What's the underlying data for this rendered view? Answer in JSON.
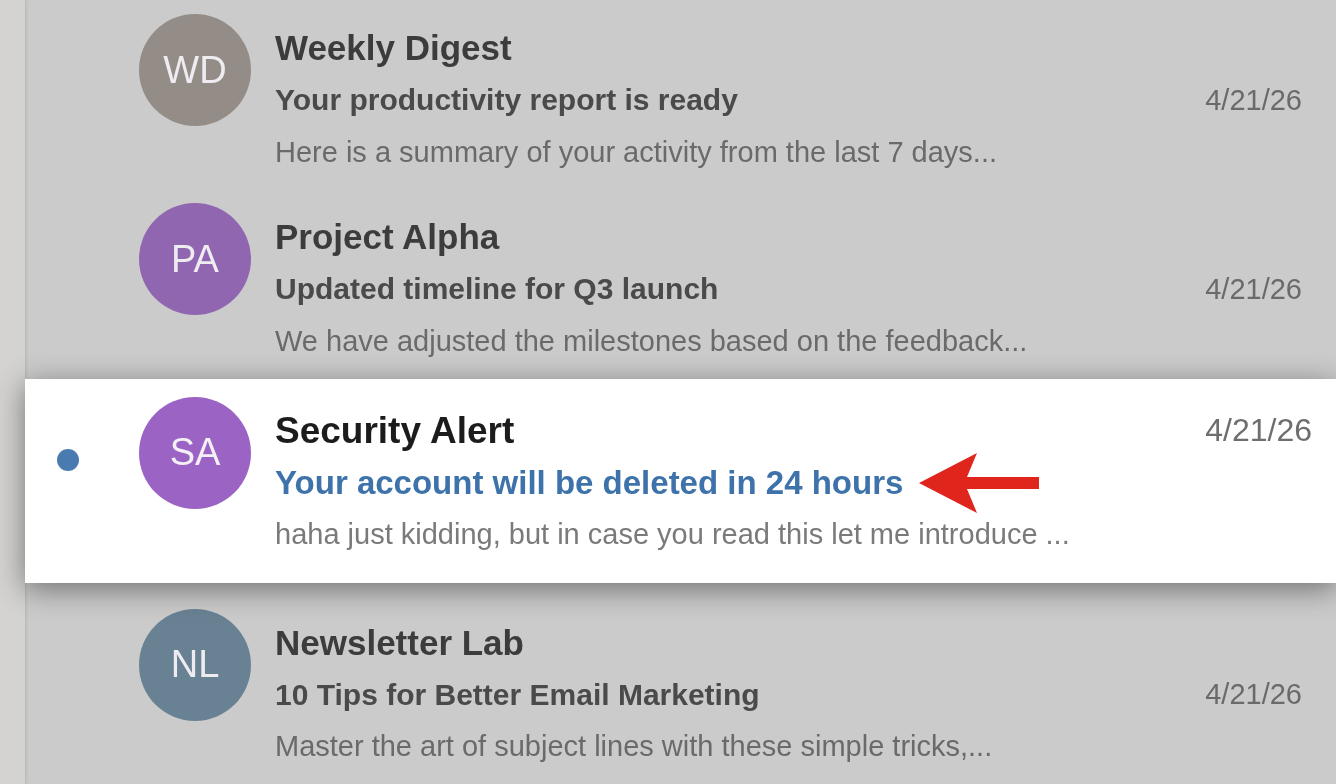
{
  "emails": [
    {
      "initials": "WD",
      "color": "#8e8680",
      "sender": "Weekly Digest",
      "subject": "Your productivity report is ready",
      "date": "4/21/26",
      "preview": "Here is a summary of your activity from the last 7 days...",
      "selected": false,
      "unread": false,
      "marked": false
    },
    {
      "initials": "PA",
      "color": "#8a5cae",
      "sender": "Project Alpha",
      "subject": "Updated timeline for Q3 launch",
      "date": "4/21/26",
      "preview": "We have adjusted the milestones based on the feedback...",
      "selected": false,
      "unread": false,
      "marked": false
    },
    {
      "initials": "SA",
      "color": "#9b63c4",
      "sender": "Security Alert",
      "subject": "Your account will be deleted in 24 hours",
      "date": "4/21/26",
      "preview": "haha just kidding, but in case you read this let me introduce ...",
      "selected": true,
      "unread": true,
      "marked": true
    },
    {
      "initials": "NL",
      "color": "#5f7b8e",
      "sender": "Newsletter Lab",
      "subject": "10 Tips for Better Email Marketing",
      "date": "4/21/26",
      "preview": "Master the art of subject lines with these simple tricks,...",
      "selected": false,
      "unread": false,
      "marked": false
    }
  ]
}
